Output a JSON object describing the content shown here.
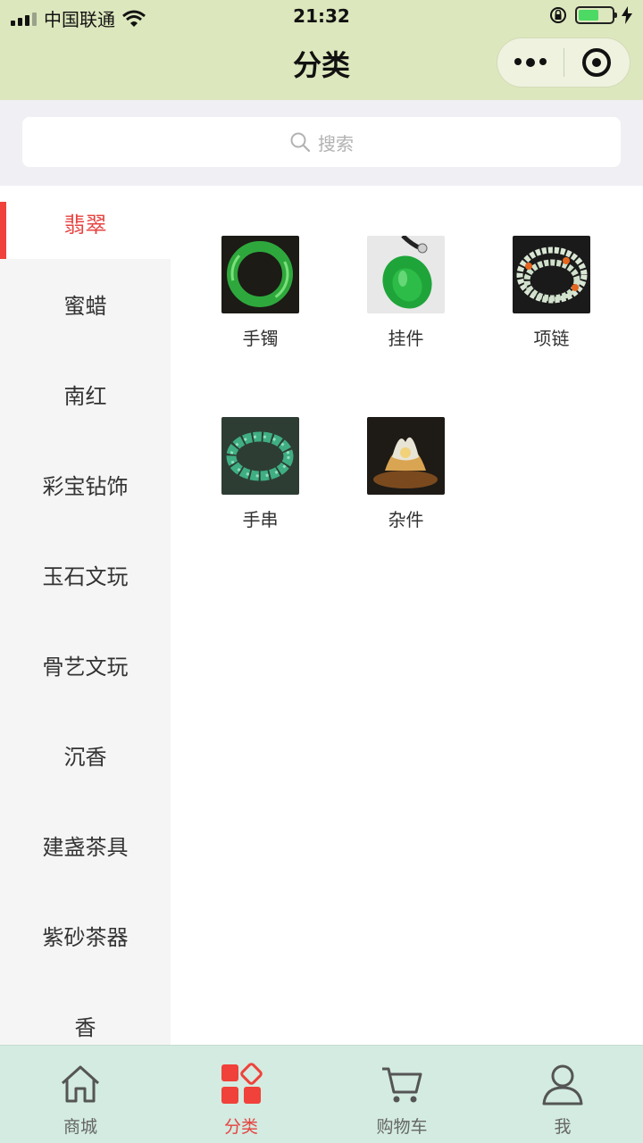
{
  "status_bar": {
    "carrier": "中国联通",
    "time": "21:32"
  },
  "header": {
    "title": "分类"
  },
  "search": {
    "placeholder": "搜索"
  },
  "sidebar": {
    "items": [
      {
        "label": "翡翠",
        "active": true
      },
      {
        "label": "蜜蜡"
      },
      {
        "label": "南红"
      },
      {
        "label": "彩宝钻饰"
      },
      {
        "label": "玉石文玩"
      },
      {
        "label": "骨艺文玩"
      },
      {
        "label": "沉香"
      },
      {
        "label": "建盏茶具"
      },
      {
        "label": "紫砂茶器"
      },
      {
        "label": "香"
      }
    ]
  },
  "subcategories": [
    {
      "label": "手镯",
      "image": "jade-bangle"
    },
    {
      "label": "挂件",
      "image": "jade-pendant"
    },
    {
      "label": "项链",
      "image": "jade-necklace"
    },
    {
      "label": "手串",
      "image": "jade-bead-bracelet"
    },
    {
      "label": "杂件",
      "image": "jade-carving"
    }
  ],
  "tabbar": {
    "items": [
      {
        "label": "商城",
        "icon": "home-icon"
      },
      {
        "label": "分类",
        "icon": "category-icon",
        "active": true
      },
      {
        "label": "购物车",
        "icon": "cart-icon"
      },
      {
        "label": "我",
        "icon": "user-icon"
      }
    ]
  },
  "colors": {
    "header_bg": "#dce7bd",
    "accent": "#e64340",
    "tabbar_bg": "#d3ebe0",
    "sidebar_bg": "#f5f5f5"
  }
}
